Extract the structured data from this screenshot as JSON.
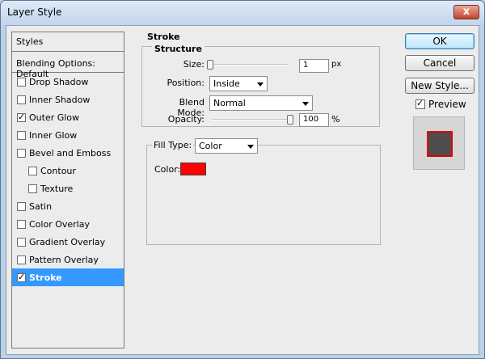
{
  "window": {
    "title": "Layer Style",
    "close_glyph": "x"
  },
  "left_panel": {
    "header": "Styles",
    "blending_options": "Blending Options: Default",
    "items": [
      {
        "label": "Drop Shadow",
        "checked": false,
        "sub": false,
        "selected": false
      },
      {
        "label": "Inner Shadow",
        "checked": false,
        "sub": false,
        "selected": false
      },
      {
        "label": "Outer Glow",
        "checked": true,
        "sub": false,
        "selected": false
      },
      {
        "label": "Inner Glow",
        "checked": false,
        "sub": false,
        "selected": false
      },
      {
        "label": "Bevel and Emboss",
        "checked": false,
        "sub": false,
        "selected": false
      },
      {
        "label": "Contour",
        "checked": false,
        "sub": true,
        "selected": false
      },
      {
        "label": "Texture",
        "checked": false,
        "sub": true,
        "selected": false
      },
      {
        "label": "Satin",
        "checked": false,
        "sub": false,
        "selected": false
      },
      {
        "label": "Color Overlay",
        "checked": false,
        "sub": false,
        "selected": false
      },
      {
        "label": "Gradient Overlay",
        "checked": false,
        "sub": false,
        "selected": false
      },
      {
        "label": "Pattern Overlay",
        "checked": false,
        "sub": false,
        "selected": false
      },
      {
        "label": "Stroke",
        "checked": true,
        "sub": false,
        "selected": true
      }
    ]
  },
  "stroke": {
    "title": "Stroke",
    "structure_title": "Structure",
    "size_label": "Size:",
    "size_value": "1",
    "size_unit": "px",
    "size_level": 0.0,
    "position_label": "Position:",
    "position_value": "Inside",
    "blend_mode_label": "Blend Mode:",
    "blend_mode_value": "Normal",
    "opacity_label": "Opacity:",
    "opacity_value": "100",
    "opacity_unit": "%",
    "opacity_level": 1.0,
    "fill_type_label": "Fill Type:",
    "fill_type_value": "Color",
    "color_label": "Color:",
    "stroke_color": "#ff0000"
  },
  "buttons": {
    "ok": "OK",
    "cancel": "Cancel",
    "new_style": "New Style...",
    "preview_label": "Preview",
    "preview_checked": true
  },
  "colors": {
    "selection": "#3399ff",
    "preview_fill": "#4d4d4d",
    "preview_stroke": "#e00000"
  }
}
